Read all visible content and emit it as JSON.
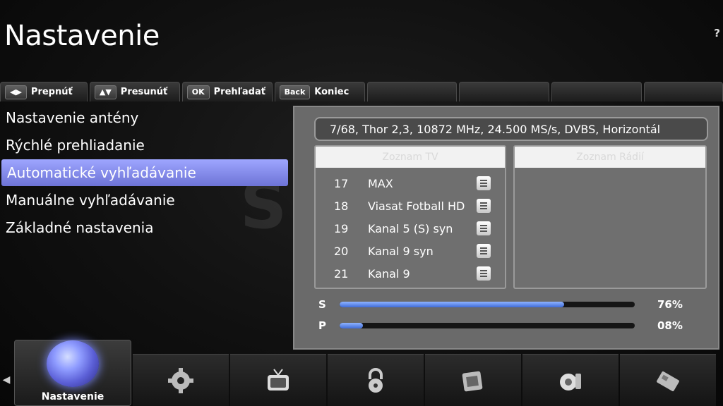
{
  "page": {
    "title": "Nastavenie",
    "help": "?"
  },
  "key_bar": {
    "items": [
      {
        "key": "◀▶",
        "label": "Prepnúť"
      },
      {
        "key": "▲▼",
        "label": "Presunúť"
      },
      {
        "key": "OK",
        "label": "Prehľadať"
      },
      {
        "key": "Back",
        "label": "Koniec"
      }
    ]
  },
  "menu": {
    "items": [
      {
        "label": "Nastavenie antény"
      },
      {
        "label": "Rýchlé prehliadanie"
      },
      {
        "label": "Automatické vyhľadávanie",
        "selected": true
      },
      {
        "label": "Manuálne vyhľadávanie"
      },
      {
        "label": "Základné nastavenia"
      }
    ]
  },
  "scan": {
    "info": "7/68, Thor 2,3, 10872 MHz, 24.500 MS/s, DVBS, Horizontál",
    "tv_list": {
      "header": "Zoznam TV",
      "channels": [
        {
          "num": "17",
          "name": "MAX"
        },
        {
          "num": "18",
          "name": "Viasat Fotball HD"
        },
        {
          "num": "19",
          "name": "Kanal 5 (S) syn"
        },
        {
          "num": "20",
          "name": "Kanal 9 syn"
        },
        {
          "num": "21",
          "name": "Kanal 9"
        }
      ]
    },
    "radio_list": {
      "header": "Zoznam Rádií",
      "channels": []
    },
    "signal": {
      "label": "S",
      "value_text": "76%",
      "level": 76
    },
    "quality": {
      "label": "P",
      "value_text": "08%",
      "level": 8
    }
  },
  "dock": {
    "active_label": "Nastavenie",
    "icons": [
      "globe-icon",
      "gear-icon",
      "tv-icon",
      "lock-icon",
      "film-icon",
      "projector-icon",
      "card-icon"
    ]
  },
  "watermark": "SATELITNÉ.SK",
  "colors": {
    "accent": "#7d8cff",
    "panel": "#6a6a6a",
    "progress": "#3f6bd8"
  }
}
